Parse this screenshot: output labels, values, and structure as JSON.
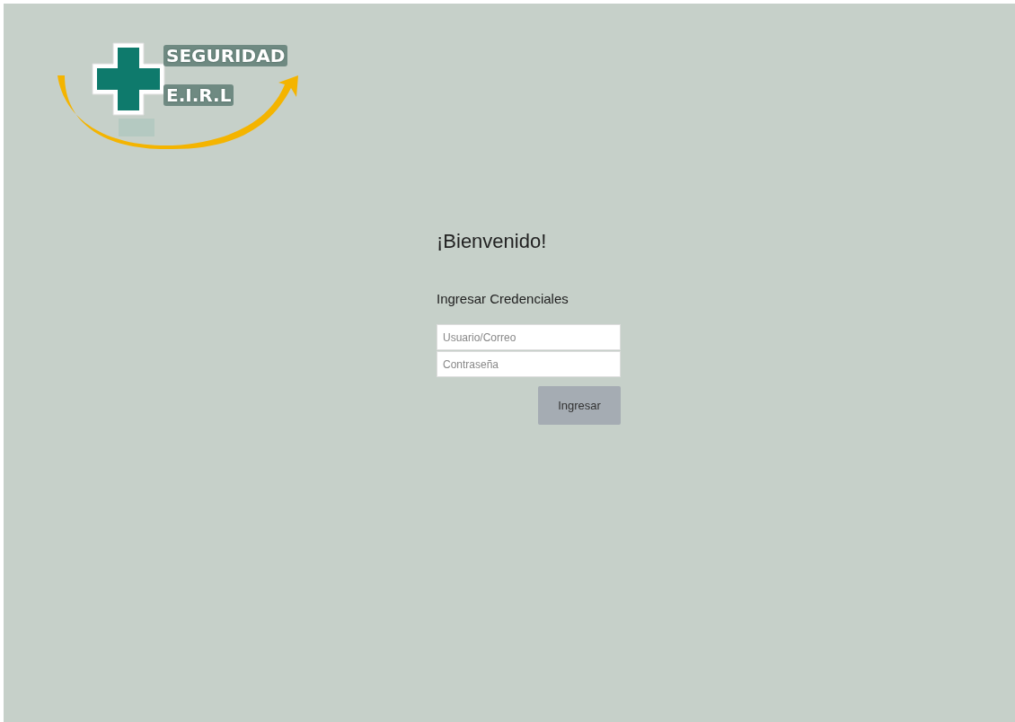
{
  "logo": {
    "line_1": "SEGURIDAD",
    "line_2": "E.I.R.L"
  },
  "login": {
    "title": "¡Bienvenido!",
    "subtitle": "Ingresar Credenciales",
    "fields": [
      {
        "placeholder": "Usuario/Correo"
      },
      {
        "placeholder": "Contraseña"
      }
    ],
    "button": "Ingresar"
  }
}
